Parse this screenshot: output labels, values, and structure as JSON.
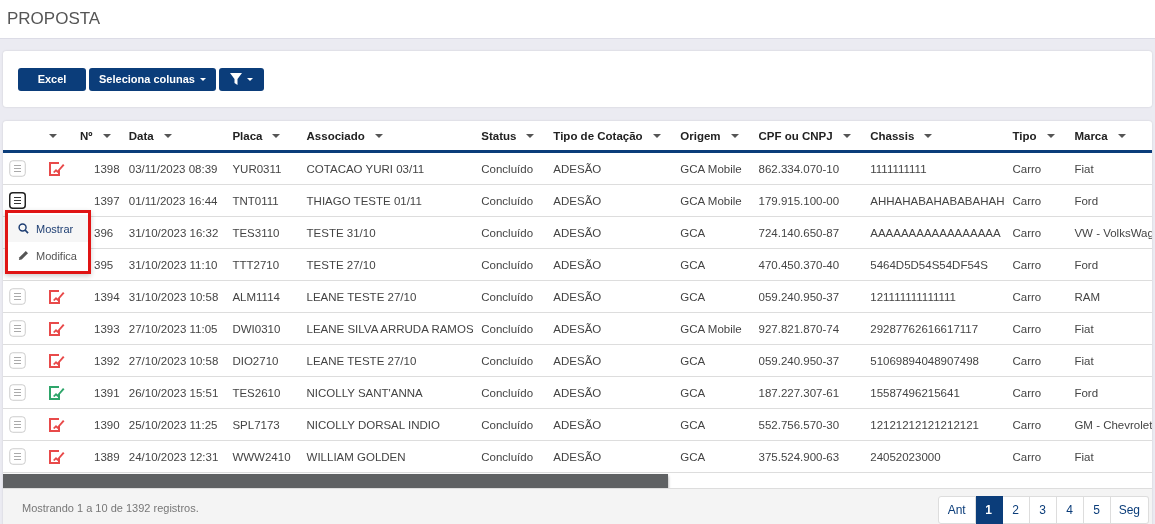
{
  "page_title": "PROPOSTA",
  "toolbar": {
    "excel": "Excel",
    "columns": "Seleciona colunas"
  },
  "table": {
    "columns": [
      "Nº",
      "Data",
      "Placa",
      "Associado",
      "Status",
      "Tipo de Cotação",
      "Origem",
      "CPF ou CNPJ",
      "Chassis",
      "Tipo",
      "Marca"
    ],
    "rows": [
      {
        "menu_active": false,
        "color": "#e84a4a",
        "cells": [
          "1398",
          "03/11/2023 08:39",
          "YUR0311",
          "COTACAO YURI 03/11",
          "Concluído",
          "ADESÃO",
          "GCA Mobile",
          "862.334.070-10",
          "1111111111",
          "Carro",
          "Fiat"
        ]
      },
      {
        "menu_active": true,
        "cells": [
          "1397",
          "01/11/2023 16:44",
          "TNT0111",
          "THIAGO TESTE 01/11",
          "Concluído",
          "ADESÃO",
          "GCA Mobile",
          "179.915.100-00",
          "AHHAHABAHABABAHAH",
          "Carro",
          "Ford"
        ]
      },
      {
        "cells": [
          "396",
          "31/10/2023 16:32",
          "TES3110",
          "TESTE 31/10",
          "Concluído",
          "ADESÃO",
          "GCA",
          "724.140.650-87",
          "AAAAAAAAAAAAAAAAA",
          "Carro",
          "VW - VolksWag"
        ]
      },
      {
        "cells": [
          "395",
          "31/10/2023 11:10",
          "TTT2710",
          "TESTE 27/10",
          "Concluído",
          "ADESÃO",
          "GCA",
          "470.450.370-40",
          "5464D5D54S54DF54S",
          "Carro",
          "Ford"
        ]
      },
      {
        "menu_active": false,
        "color": "#e84a4a",
        "cells": [
          "1394",
          "31/10/2023 10:58",
          "ALM1114",
          "LEANE TESTE 27/10",
          "Concluído",
          "ADESÃO",
          "GCA",
          "059.240.950-37",
          "121111111111111",
          "Carro",
          "RAM"
        ]
      },
      {
        "menu_active": false,
        "color": "#e84a4a",
        "cells": [
          "1393",
          "27/10/2023 11:05",
          "DWI0310",
          "LEANE SILVA ARRUDA RAMOS",
          "Concluído",
          "ADESÃO",
          "GCA Mobile",
          "927.821.870-74",
          "29287762616617117",
          "Carro",
          "Fiat"
        ]
      },
      {
        "menu_active": false,
        "color": "#e84a4a",
        "cells": [
          "1392",
          "27/10/2023 10:58",
          "DIO2710",
          "LEANE TESTE 27/10",
          "Concluído",
          "ADESÃO",
          "GCA",
          "059.240.950-37",
          "51069894048907498",
          "Carro",
          "Fiat"
        ]
      },
      {
        "menu_active": false,
        "color": "#2ea56a",
        "cells": [
          "1391",
          "26/10/2023 15:51",
          "TES2610",
          "NICOLLY SANT'ANNA",
          "Concluído",
          "ADESÃO",
          "GCA",
          "187.227.307-61",
          "15587496215641",
          "Carro",
          "Ford"
        ]
      },
      {
        "menu_active": false,
        "color": "#e84a4a",
        "cells": [
          "1390",
          "25/10/2023 11:25",
          "SPL7173",
          "NICOLLY DORSAL INDIO",
          "Concluído",
          "ADESÃO",
          "GCA",
          "552.756.570-30",
          "12121212121212121",
          "Carro",
          "GM - Chevrolet"
        ]
      },
      {
        "menu_active": false,
        "color": "#e84a4a",
        "cells": [
          "1389",
          "24/10/2023 12:31",
          "WWW2410",
          "WILLIAM GOLDEN",
          "Concluído",
          "ADESÃO",
          "GCA",
          "375.524.900-63",
          "24052023000",
          "Carro",
          "Fiat"
        ]
      }
    ]
  },
  "row_menu": [
    {
      "kind": "show",
      "label": "Mostrar",
      "selected": true
    },
    {
      "kind": "edit",
      "label": "Modifica",
      "selected": false
    }
  ],
  "footer": {
    "info": "Mostrando 1 a 10 de 1392 registros.",
    "pages": [
      {
        "label": "Ant",
        "selected": false
      },
      {
        "label": "1",
        "selected": true
      },
      {
        "label": "2",
        "selected": false
      },
      {
        "label": "3",
        "selected": false
      },
      {
        "label": "4",
        "selected": false
      },
      {
        "label": "5",
        "selected": false
      },
      {
        "label": "Seg",
        "selected": false
      }
    ]
  }
}
